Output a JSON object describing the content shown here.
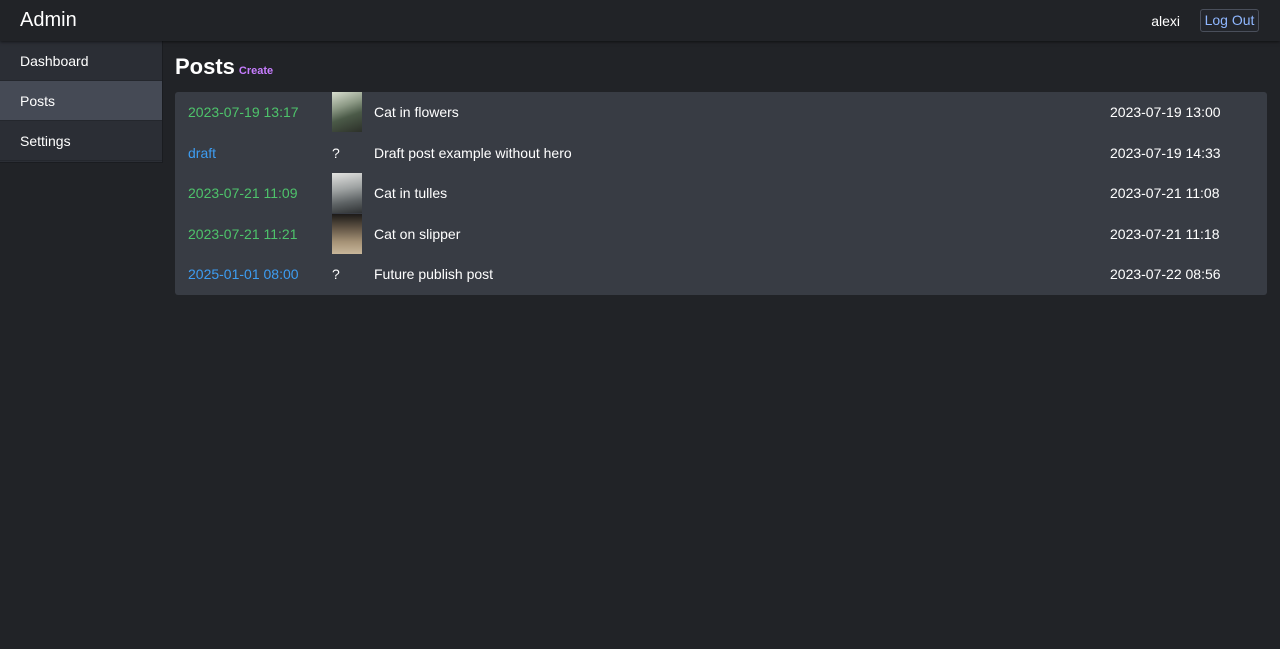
{
  "header": {
    "title": "Admin",
    "username": "alexi",
    "logout_label": "Log Out"
  },
  "sidebar": {
    "items": [
      {
        "label": "Dashboard",
        "active": false
      },
      {
        "label": "Posts",
        "active": true
      },
      {
        "label": "Settings",
        "active": false
      }
    ]
  },
  "main": {
    "heading": "Posts",
    "create_label": "Create"
  },
  "posts": [
    {
      "status": "2023-07-19 13:17",
      "status_color": "#4ec36b",
      "thumb": "image",
      "title": "Cat in flowers",
      "date": "2023-07-19 13:00"
    },
    {
      "status": "draft",
      "status_color": "#3d9df2",
      "thumb": "?",
      "title": "Draft post example without hero",
      "date": "2023-07-19 14:33"
    },
    {
      "status": "2023-07-21 11:09",
      "status_color": "#4ec36b",
      "thumb": "image",
      "title": "Cat in tulles",
      "date": "2023-07-21 11:08"
    },
    {
      "status": "2023-07-21 11:21",
      "status_color": "#4ec36b",
      "thumb": "image",
      "title": "Cat on slipper",
      "date": "2023-07-21 11:18"
    },
    {
      "status": "2025-01-01 08:00",
      "status_color": "#3d9df2",
      "thumb": "?",
      "title": "Future publish post",
      "date": "2023-07-22 08:56"
    }
  ],
  "colors": {
    "background": "#212327",
    "panel": "#383c44",
    "sidebar": "#2b2e35",
    "sidebar_active": "#454a55",
    "published": "#4ec36b",
    "scheduled_or_draft": "#3d9df2",
    "create_link": "#c77dff"
  }
}
